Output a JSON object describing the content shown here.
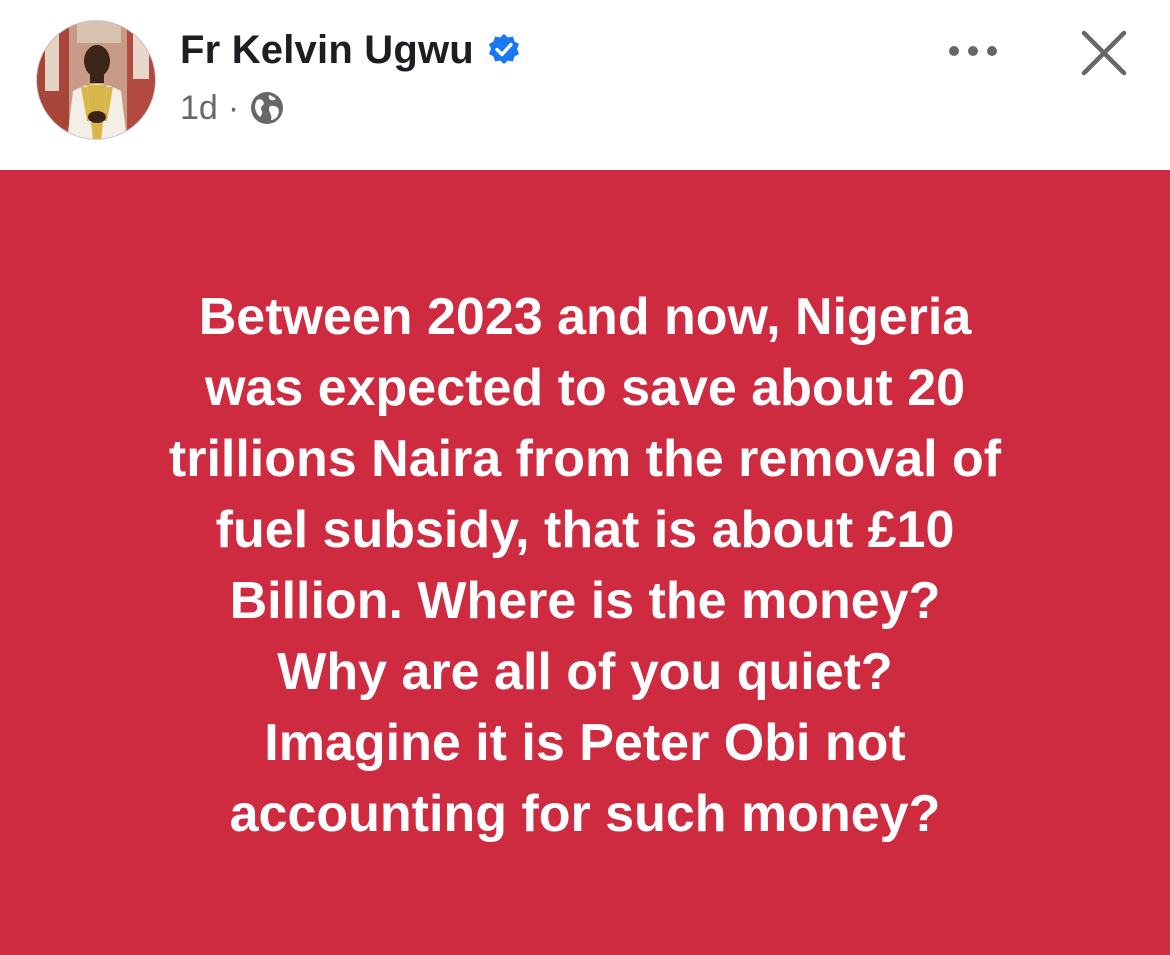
{
  "header": {
    "author_name": "Fr Kelvin Ugwu",
    "timestamp": "1d",
    "separator": "·",
    "privacy_icon": "globe-icon",
    "verified_icon": "verified-badge-icon",
    "more_icon": "more-options-icon",
    "close_icon": "close-icon",
    "verified_color": "#1877f2"
  },
  "post": {
    "background_color": "#ce2a40",
    "text_color": "#ffffff",
    "lines": [
      "Between 2023 and now, Nigeria",
      "was expected to save about 20",
      "trillions Naira from the removal of",
      "fuel subsidy, that is about £10",
      "Billion. Where is the money?",
      "Why are all of you quiet?",
      "Imagine it is Peter Obi not",
      "accounting for such money?"
    ]
  }
}
